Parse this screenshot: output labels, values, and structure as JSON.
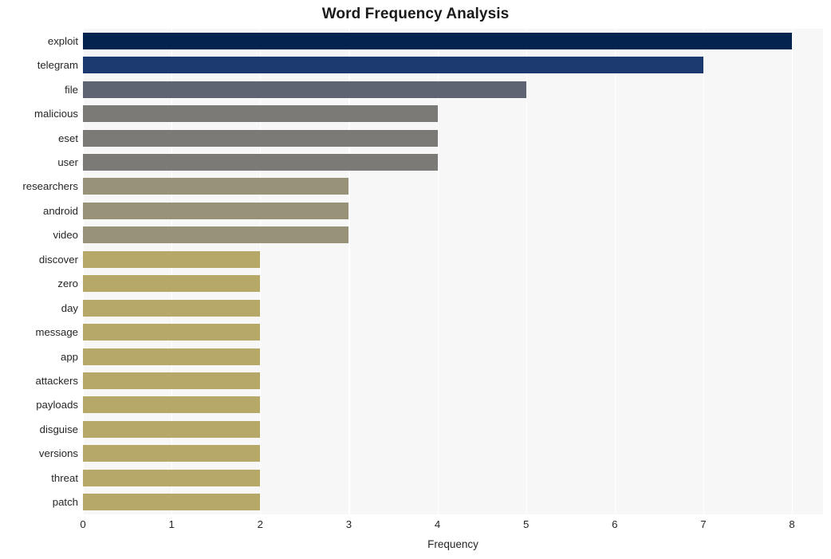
{
  "chart_data": {
    "type": "bar",
    "orientation": "horizontal",
    "title": "Word Frequency Analysis",
    "xlabel": "Frequency",
    "ylabel": "",
    "xlim": [
      0,
      8.35
    ],
    "ylim": [
      0,
      20
    ],
    "xticks": [
      "0",
      "1",
      "2",
      "3",
      "4",
      "5",
      "6",
      "7",
      "8"
    ],
    "xtick_values": [
      0,
      1,
      2,
      3,
      4,
      5,
      6,
      7,
      8
    ],
    "grid": "vertical-white-on-light-gray",
    "legend": "none",
    "categories": [
      "exploit",
      "telegram",
      "file",
      "malicious",
      "eset",
      "user",
      "researchers",
      "android",
      "video",
      "discover",
      "zero",
      "day",
      "message",
      "app",
      "attackers",
      "payloads",
      "disguise",
      "versions",
      "threat",
      "patch"
    ],
    "values": [
      8,
      7,
      5,
      4,
      4,
      4,
      3,
      3,
      3,
      2,
      2,
      2,
      2,
      2,
      2,
      2,
      2,
      2,
      2,
      2
    ],
    "bar_colors": [
      "#04244f",
      "#1c3a70",
      "#5e6472",
      "#7b7a77",
      "#7b7a77",
      "#7b7a77",
      "#989378",
      "#989378",
      "#989378",
      "#b5a868",
      "#b5a868",
      "#b5a868",
      "#b5a868",
      "#b5a868",
      "#b5a868",
      "#b5a868",
      "#b5a868",
      "#b5a868",
      "#b5a868",
      "#b5a868"
    ],
    "plot_background": "#f7f7f7",
    "figure_background": "#ffffff",
    "gridline_color": "#ffffff",
    "text_color": "#262626"
  }
}
